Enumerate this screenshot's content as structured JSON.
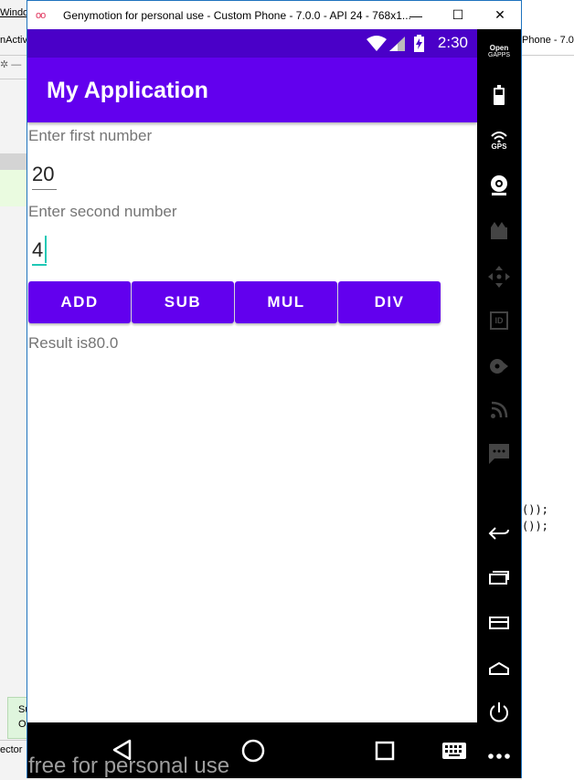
{
  "background_ide": {
    "menu_fragment": "Windo",
    "tab_fragment_left": "nActiv",
    "tab_fragment_right": "Phone - 7.0",
    "code_line_1": "());",
    "code_line_2": "());",
    "notif_line_1": "Su",
    "notif_line_2": "O",
    "bottom_tab": "ector"
  },
  "window": {
    "title": "Genymotion for personal use - Custom Phone - 7.0.0 - API 24 - 768x1...",
    "minimize_glyph": "—",
    "maximize_glyph": "☐",
    "close_glyph": "✕"
  },
  "statusbar": {
    "time": "2:30"
  },
  "app": {
    "title": "My Application",
    "first_label": "Enter first number",
    "first_value": "20",
    "second_label": "Enter second number",
    "second_value": "4",
    "buttons": [
      "ADD",
      "SUB",
      "MUL",
      "DIV"
    ],
    "result": "Result is80.0",
    "accent_color": "#6200ee",
    "statusbar_color": "#4a00c8"
  },
  "watermark": "free for personal use",
  "toolbar": {
    "opengapps_line1": "Open",
    "opengapps_line2": "GAPPS",
    "gps_label": "GPS",
    "id_label": "ID",
    "icons": [
      "opengapps-icon",
      "battery-icon",
      "gps-icon",
      "webcam-icon",
      "media-icon",
      "dpad-icon",
      "identifier-icon",
      "disk-io-icon",
      "cast-icon",
      "sms-icon",
      "back-icon",
      "recent-apps-icon",
      "menu-icon",
      "home-icon",
      "power-icon",
      "more-icon"
    ]
  }
}
